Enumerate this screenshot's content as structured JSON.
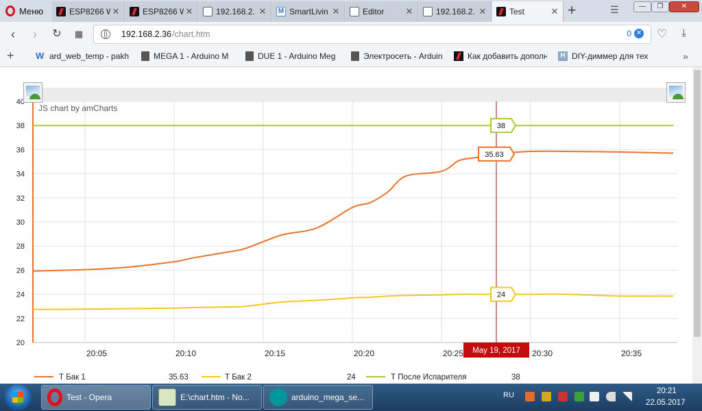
{
  "browser": {
    "menu_label": "Меню",
    "tabs": [
      {
        "label": "ESP8266 W",
        "icon": "arduino-icon"
      },
      {
        "label": "ESP8266 W",
        "icon": "arduino-icon"
      },
      {
        "label": "192.168.2.",
        "icon": "page-icon"
      },
      {
        "label": "SmartLivin",
        "icon": "m-icon"
      },
      {
        "label": "Editor",
        "icon": "page-icon"
      },
      {
        "label": "192.168.2.",
        "icon": "page-icon"
      },
      {
        "label": "Test",
        "icon": "arduino-icon"
      }
    ],
    "address": {
      "host": "192.168.2.36",
      "path": "/chart.htm"
    },
    "adblock_count": "0",
    "bookmarks": [
      {
        "label": "ard_web_temp - pakh",
        "icon": "w-icon"
      },
      {
        "label": "MEGA 1 - Arduino M",
        "icon": "doc-icon"
      },
      {
        "label": "DUE 1 - Arduino Meg",
        "icon": "doc-icon"
      },
      {
        "label": "Электросеть - Arduin",
        "icon": "doc-icon"
      },
      {
        "label": "Как добавить дополн",
        "icon": "arduino-icon"
      },
      {
        "label": "DIY-диммер для тех",
        "icon": "h-icon"
      }
    ]
  },
  "chart_data": {
    "type": "line",
    "watermark": "JS chart by amCharts",
    "x_ticks": [
      "20:05",
      "20:10",
      "20:15",
      "20:20",
      "20:25",
      "20:30",
      "20:35"
    ],
    "ylim": [
      20,
      40
    ],
    "y_ticks": [
      20,
      22,
      24,
      26,
      28,
      30,
      32,
      34,
      36,
      38,
      40
    ],
    "grid": true,
    "cursor_label": "May 19, 2017",
    "x_minutes": [
      -1,
      1,
      4,
      7,
      10,
      11,
      13,
      14,
      16,
      18,
      20,
      21,
      22,
      23,
      25,
      26,
      27,
      28,
      30,
      32,
      35,
      38
    ],
    "series": [
      {
        "name": "Т Бак 1",
        "color": "#e8732a",
        "legend_value": "35.63",
        "balloon": "35.63",
        "values": [
          26.8,
          26.0,
          26.0,
          26.2,
          26.7,
          27.0,
          27.5,
          27.8,
          28.9,
          29.5,
          31.2,
          31.6,
          32.5,
          33.8,
          34.2,
          35.1,
          35.35,
          35.63,
          35.85,
          35.85,
          35.8,
          35.7
        ]
      },
      {
        "name": "Т Бак 2",
        "color": "#f2c81f",
        "legend_value": "24",
        "balloon": "24",
        "values": [
          22.9,
          22.75,
          22.75,
          22.8,
          22.85,
          22.9,
          22.95,
          23.0,
          23.35,
          23.5,
          23.7,
          23.75,
          23.85,
          23.9,
          23.95,
          24.0,
          24.0,
          24.0,
          24.0,
          24.0,
          23.85,
          23.85
        ]
      },
      {
        "name": "Т После Испарителя",
        "color": "#a7c930",
        "legend_value": "38",
        "balloon": "38",
        "values": [
          38,
          38,
          38,
          38,
          38,
          38,
          38,
          38,
          38,
          38,
          38,
          38,
          38,
          38,
          38,
          38,
          38,
          38,
          38,
          38,
          38,
          38
        ]
      }
    ]
  },
  "taskbar": {
    "tasks": [
      {
        "label": "Test - Opera"
      },
      {
        "label": "E:\\chart.htm - No..."
      },
      {
        "label": "arduino_mega_se..."
      }
    ],
    "language": "RU",
    "time": "20:21",
    "date": "22.05.2017"
  }
}
